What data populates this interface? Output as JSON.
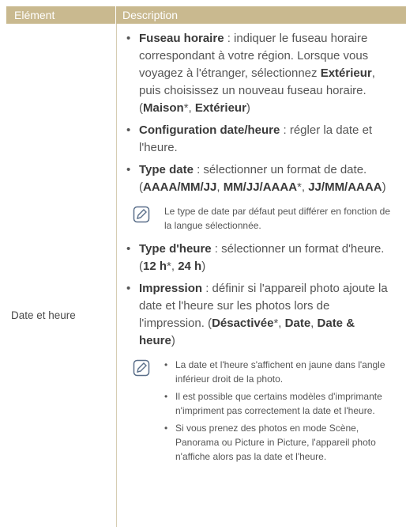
{
  "header": {
    "col1": "Elément",
    "col2": "Description"
  },
  "row_label": "Date et heure",
  "items": [
    {
      "term": "Fuseau horaire",
      "text": " : indiquer le fuseau horaire correspondant à votre région. Lorsque vous voyagez à l'étranger, sélectionnez ",
      "b1": "Extérieur",
      "t2": ", puis choisissez un nouveau fuseau horaire. (",
      "b2": "Maison",
      "t3": "*, ",
      "b3": "Extérieur",
      "t4": ")"
    },
    {
      "term": "Configuration date/heure",
      "text": " : régler la date et l'heure."
    },
    {
      "term": "Type date",
      "text": " : sélectionner un format de date. (",
      "b1": "AAAA/MM/JJ",
      "t2": ", ",
      "b2": "MM/JJ/AAAA",
      "t3": "*, ",
      "b3": "JJ/MM/AAAA",
      "t4": ")"
    },
    {
      "term": "Type d'heure",
      "text": " : sélectionner un format d'heure. (",
      "b1": "12 h",
      "t2": "*, ",
      "b2": "24 h",
      "t3": ")"
    },
    {
      "term": "Impression",
      "text": " : définir si l'appareil photo ajoute la date et l'heure sur les photos lors de l'impression. (",
      "b1": "Désactivée",
      "t2": "*, ",
      "b2": "Date",
      "t3": ", ",
      "b3": "Date & heure",
      "t4": ")"
    }
  ],
  "note1": "Le type de date par défaut peut différer en fonction de la langue sélectionnée.",
  "note2": [
    "La date et l'heure s'affichent en jaune dans l'angle inférieur droit de la photo.",
    "Il est possible que certains modèles d'imprimante n'impriment pas correctement la date et l'heure.",
    "Si vous prenez des photos en mode Scène, Panorama ou Picture in Picture, l'appareil photo n'affiche alors pas la date et l'heure."
  ]
}
